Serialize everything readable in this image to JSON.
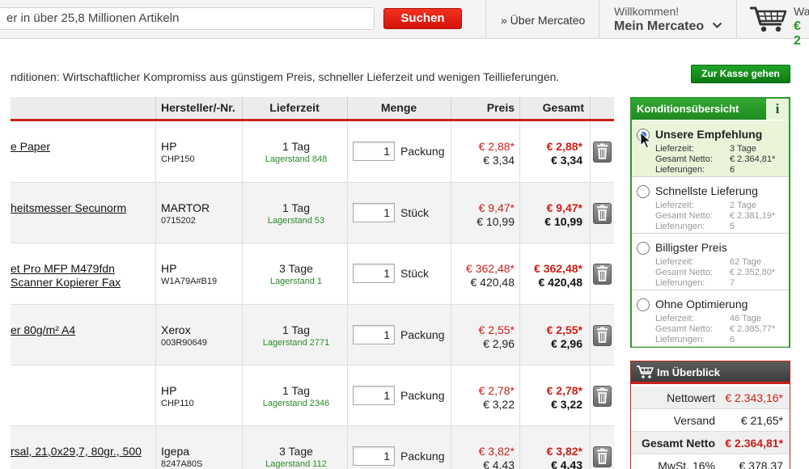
{
  "header": {
    "search_text": "er in über 25,8 Millionen Artikeln",
    "search_button": "Suchen",
    "about_link": "» Über Mercateo",
    "welcome": "Willkommen!",
    "account": "Mein Mercateo",
    "cart_label": "Wa",
    "cart_amount": "€ 2"
  },
  "info_text": "nditionen: Wirtschaftlicher Kompromiss aus günstigem Preis, schneller Lieferzeit und wenigen Teillieferungen.",
  "checkout_button": "Zur Kasse gehen",
  "table": {
    "headers": {
      "manufacturer": "Hersteller/-Nr.",
      "delivery": "Lieferzeit",
      "quantity": "Menge",
      "price": "Preis",
      "total": "Gesamt"
    },
    "rows": [
      {
        "name": [
          "e Paper"
        ],
        "manufacturer": "HP",
        "sku": "CHP150",
        "delivery": "1 Tag",
        "stock": "Lagerstand 848",
        "qty": "1",
        "unit": "Packung",
        "price_net": "€ 2,88*",
        "price_gross": "€ 3,34",
        "total_net": "€ 2,88*",
        "total_gross": "€ 3,34"
      },
      {
        "name": [
          "heitsmesser Secunorm"
        ],
        "manufacturer": "MARTOR",
        "sku": "0715202",
        "delivery": "1 Tag",
        "stock": "Lagerstand 53",
        "qty": "1",
        "unit": "Stück",
        "price_net": "€ 9,47*",
        "price_gross": "€ 10,99",
        "total_net": "€ 9,47*",
        "total_gross": "€ 10,99"
      },
      {
        "name": [
          "et Pro MFP M479fdn",
          "Scanner Kopierer Fax"
        ],
        "manufacturer": "HP",
        "sku": "W1A79A#B19",
        "delivery": "3 Tage",
        "stock": "Lagerstand 1",
        "qty": "1",
        "unit": "Stück",
        "price_net": "€ 362,48*",
        "price_gross": "€ 420,48",
        "total_net": "€ 362,48*",
        "total_gross": "€ 420,48"
      },
      {
        "name": [
          "er 80g/m² A4"
        ],
        "manufacturer": "Xerox",
        "sku": "003R90649",
        "delivery": "1 Tag",
        "stock": "Lagerstand 2771",
        "qty": "1",
        "unit": "Packung",
        "price_net": "€ 2,55*",
        "price_gross": "€ 2,96",
        "total_net": "€ 2,55*",
        "total_gross": "€ 2,96"
      },
      {
        "name": [
          ""
        ],
        "manufacturer": "HP",
        "sku": "CHP110",
        "delivery": "1 Tag",
        "stock": "Lagerstand 2346",
        "qty": "1",
        "unit": "Packung",
        "price_net": "€ 2,78*",
        "price_gross": "€ 3,22",
        "total_net": "€ 2,78*",
        "total_gross": "€ 3,22"
      },
      {
        "name": [
          "rsal, 21,0x29,7, 80gr., 500"
        ],
        "manufacturer": "Igepa",
        "sku": "8247A80S",
        "delivery": "3 Tage",
        "stock": "Lagerstand 112",
        "qty": "1",
        "unit": "Packung",
        "price_net": "€ 3,82*",
        "price_gross": "€ 4,43",
        "total_net": "€ 3,82*",
        "total_gross": "€ 4,43"
      }
    ]
  },
  "conditions": {
    "title": "Konditionsübersicht",
    "info_glyph": "i",
    "labels": {
      "delivery": "Lieferzeit:",
      "total": "Gesamt Netto:",
      "shipments": "Lieferungen:"
    },
    "options": [
      {
        "title": "Unsere Empfehlung",
        "delivery": "3 Tage",
        "total": "€ 2.364,81*",
        "shipments": "6",
        "selected": true
      },
      {
        "title": "Schnellste Lieferung",
        "delivery": "2 Tage",
        "total": "€ 2.381,19*",
        "shipments": "5",
        "selected": false
      },
      {
        "title": "Billigster Preis",
        "delivery": "62 Tage",
        "total": "€ 2.352,80*",
        "shipments": "7",
        "selected": false
      },
      {
        "title": "Ohne Optimierung",
        "delivery": "46 Tage",
        "total": "€ 2.385,77*",
        "shipments": "6",
        "selected": false
      }
    ]
  },
  "overview": {
    "title": "Im Überblick",
    "rows": [
      {
        "label": "Nettowert",
        "value": "€ 2.343,16*"
      },
      {
        "label": "Versand",
        "value": "€ 21,65*"
      },
      {
        "label": "Gesamt Netto",
        "value": "€ 2.364,81*"
      },
      {
        "label": "MwSt. 16%",
        "value": "€ 378,37"
      }
    ]
  },
  "colors": {
    "accent_red": "#c9201a",
    "accent_green": "#2b9a2b",
    "stock_green": "#2a8a2a"
  }
}
